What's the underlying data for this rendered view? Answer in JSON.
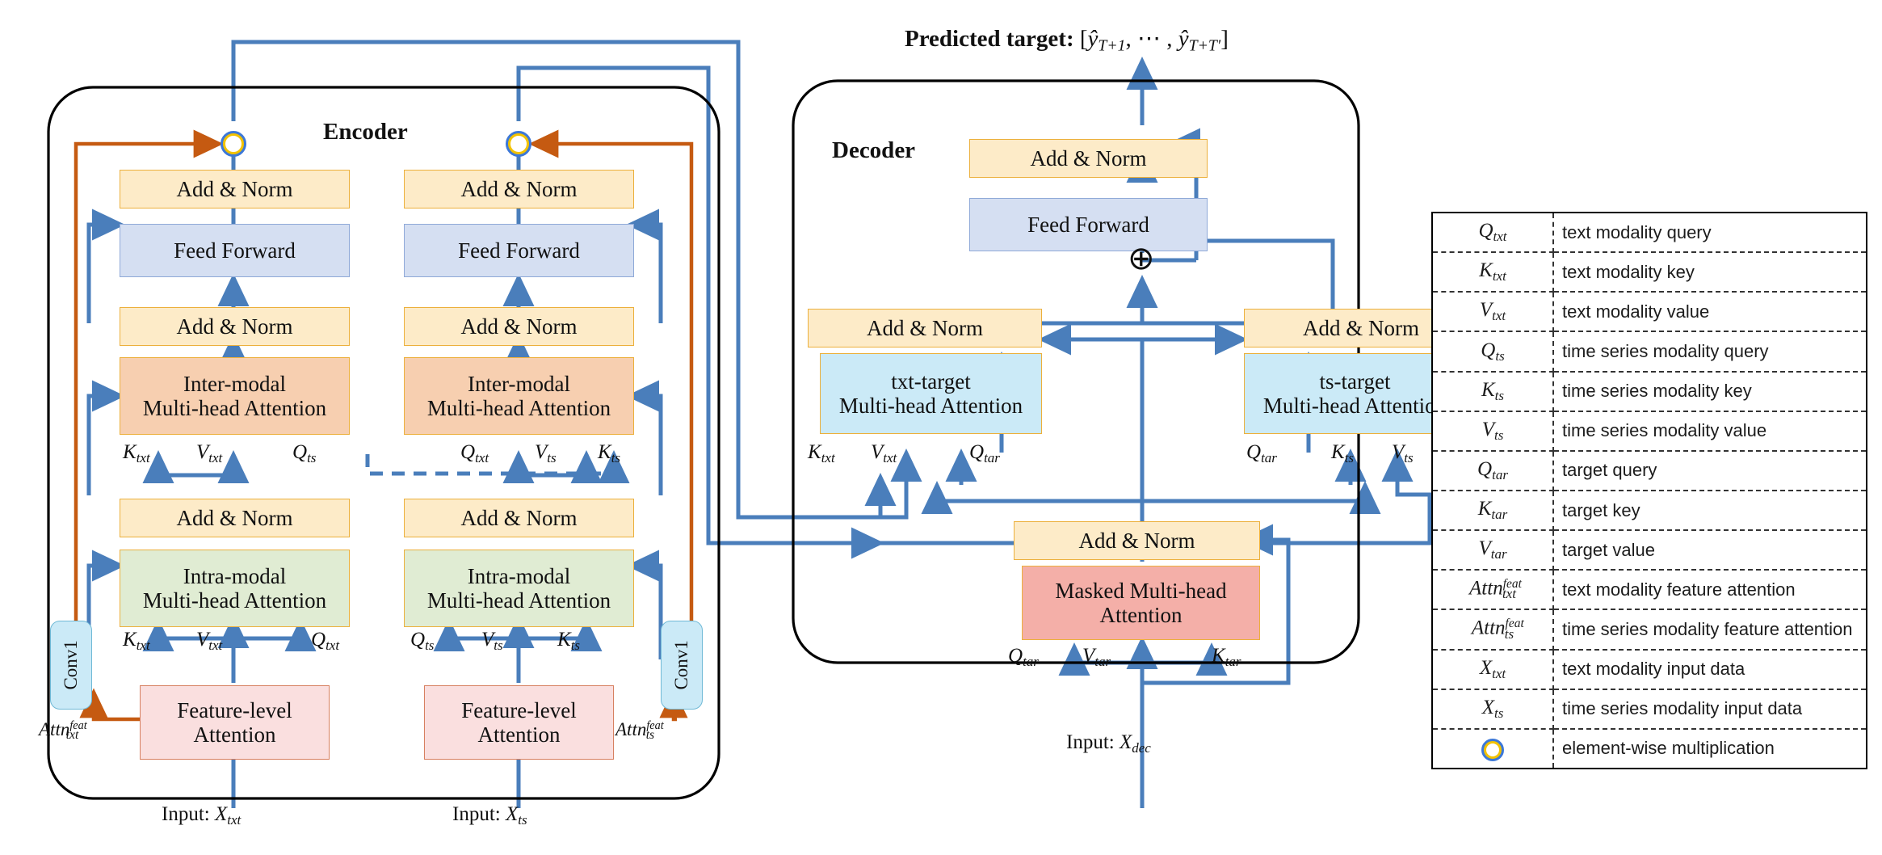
{
  "title": {
    "predicted_target": "Predicted target:",
    "predicted_target_vector": "[ŷ T+1 , ⋯ , ŷ T+T′ ]"
  },
  "encoder": {
    "label": "Encoder",
    "text_column": {
      "input_label": "Input:",
      "input_var": "X txt",
      "feature_attention": "Feature-level\nAttention",
      "feature_attention_line1": "Feature-level",
      "feature_attention_line2": "Attention",
      "conv": "Conv1",
      "attn_feat_label": "Attn feat txt",
      "intra_modal_line1": "Intra-modal",
      "intra_modal_line2": "Multi-head Attention",
      "intra_inputs": [
        "K txt",
        "V txt",
        "Q txt"
      ],
      "add_norm_1": "Add & Norm",
      "inter_modal_line1": "Inter-modal",
      "inter_modal_line2": "Multi-head Attention",
      "inter_inputs": [
        "K txt",
        "V txt",
        "Q ts"
      ],
      "add_norm_2": "Add & Norm",
      "feed_forward": "Feed Forward",
      "add_norm_3": "Add & Norm"
    },
    "ts_column": {
      "input_label": "Input:",
      "input_var": "X ts",
      "feature_attention_line1": "Feature-level",
      "feature_attention_line2": "Attention",
      "conv": "Conv1",
      "attn_feat_label": "Attn feat ts",
      "intra_modal_line1": "Intra-modal",
      "intra_modal_line2": "Multi-head Attention",
      "intra_inputs": [
        "Q ts",
        "V ts",
        "K ts"
      ],
      "add_norm_1": "Add & Norm",
      "inter_modal_line1": "Inter-modal",
      "inter_modal_line2": "Multi-head Attention",
      "inter_inputs": [
        "Q txt",
        "V ts",
        "K ts"
      ],
      "add_norm_2": "Add & Norm",
      "feed_forward": "Feed Forward",
      "add_norm_3": "Add & Norm"
    }
  },
  "decoder": {
    "label": "Decoder",
    "input_label": "Input:",
    "input_var": "X dec",
    "masked_attention_line1": "Masked Multi-head",
    "masked_attention_line2": "Attention",
    "masked_inputs": [
      "Q tar",
      "V tar",
      "K tar"
    ],
    "add_norm_masked": "Add & Norm",
    "txt_target_line1": "txt-target",
    "txt_target_line2": "Multi-head Attention",
    "txt_target_inputs": [
      "K txt",
      "V txt",
      "Q tar"
    ],
    "add_norm_txt": "Add & Norm",
    "ts_target_line1": "ts-target",
    "ts_target_line2": "Multi-head Attention",
    "ts_target_inputs": [
      "Q tar",
      "K ts",
      "V ts"
    ],
    "add_norm_ts": "Add & Norm",
    "sum_symbol": "⊕",
    "feed_forward": "Feed Forward",
    "add_norm_top": "Add & Norm"
  },
  "legend": {
    "rows": [
      {
        "symbol": "Q txt",
        "desc": "text modality query"
      },
      {
        "symbol": "K txt",
        "desc": "text modality key"
      },
      {
        "symbol": "V txt",
        "desc": "text modality value"
      },
      {
        "symbol": "Q ts",
        "desc": "time series modality query"
      },
      {
        "symbol": "K ts",
        "desc": "time series modality key"
      },
      {
        "symbol": "V ts",
        "desc": "time series modality value"
      },
      {
        "symbol": "Q tar",
        "desc": "target query"
      },
      {
        "symbol": "K tar",
        "desc": "target key"
      },
      {
        "symbol": "V tar",
        "desc": "target value"
      },
      {
        "symbol": "Attn feat txt",
        "desc": "text modality feature attention"
      },
      {
        "symbol": "Attn feat ts",
        "desc": "time series modality feature attention"
      },
      {
        "symbol": "X txt",
        "desc": "text modality input data"
      },
      {
        "symbol": "X ts",
        "desc": "time series modality input data"
      },
      {
        "symbol": "element-wise-multiplication-icon",
        "desc": "element-wise multiplication"
      }
    ]
  },
  "colors": {
    "add_norm": "#fdebc8",
    "feed_forward": "#d5dff2",
    "inter_modal": "#f7cfb0",
    "intra_modal": "#e0ecd3",
    "feature_attention": "#fadfdf",
    "masked_attention": "#f4afa8",
    "cross_attention": "#cbeaf7",
    "conv": "#cbeaf7",
    "wire_blue": "#4a7ebb",
    "wire_orange": "#c55a11",
    "ewm_ring": "#f2c200"
  }
}
